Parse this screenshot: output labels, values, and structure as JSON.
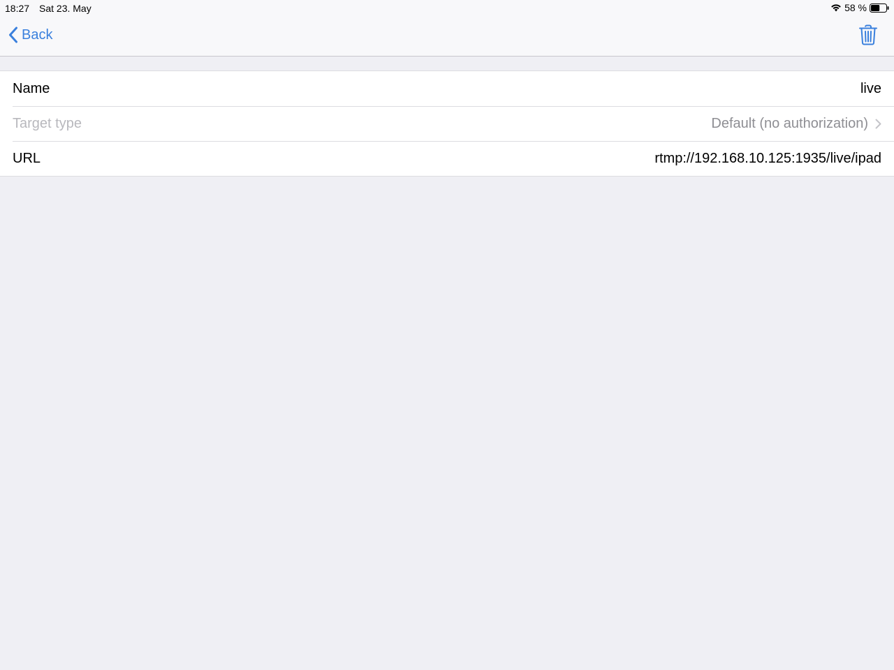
{
  "status_bar": {
    "time": "18:27",
    "date": "Sat 23. May",
    "battery_text": "58 %",
    "battery_level": 0.58,
    "icons": [
      "wifi-icon",
      "battery-icon"
    ]
  },
  "nav": {
    "back_label": "Back",
    "back_icon": "chevron-left-icon",
    "action_icon": "trash-icon",
    "accent_color": "#3a80dd"
  },
  "fields": [
    {
      "label": "Name",
      "value": "live"
    },
    {
      "label": "Target type",
      "value": "Default (no authorization)",
      "icon": "chevron-right-icon"
    },
    {
      "label": "URL",
      "value": "rtmp://192.168.10.125:1935/live/ipad"
    }
  ]
}
